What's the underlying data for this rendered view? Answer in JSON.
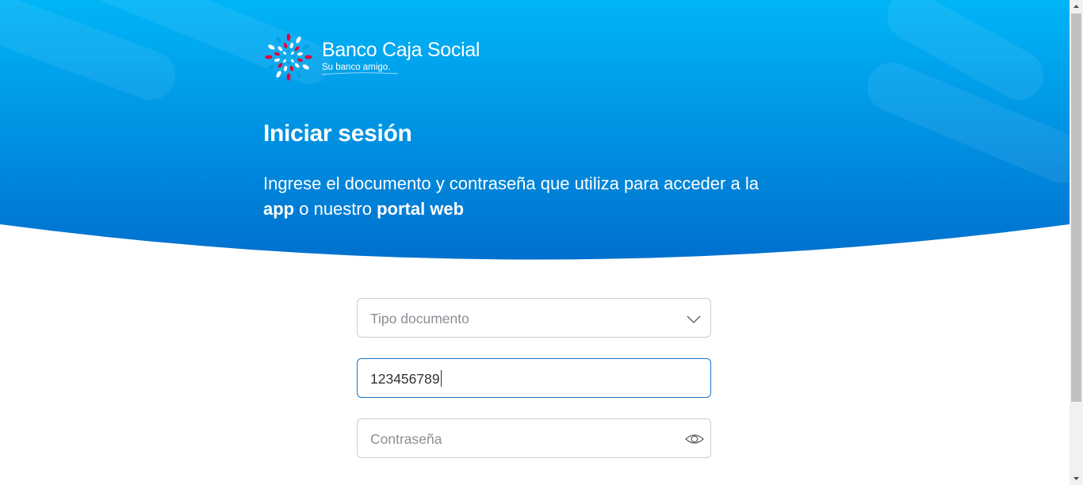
{
  "brand": {
    "name": "Banco Caja Social",
    "tagline": "Su banco amigo."
  },
  "page": {
    "title": "Iniciar sesión",
    "intro_part1": "Ingrese el documento y contraseña que utiliza para acceder a la",
    "intro_app": "app",
    "intro_part2": " o nuestro ",
    "intro_portal": "portal web"
  },
  "form": {
    "document_type": {
      "placeholder": "Tipo documento",
      "icon": "chevron-down-icon"
    },
    "document_number": {
      "value": "123456789"
    },
    "password": {
      "placeholder": "Contraseña",
      "icon": "eye-icon"
    }
  },
  "colors": {
    "hero_top": "#00b4f6",
    "hero_bottom": "#0071cf",
    "focus_border": "#1d74c6",
    "field_border": "#c8ccd1",
    "logo_red": "#e4003a",
    "logo_blue": "#00a0e3"
  }
}
